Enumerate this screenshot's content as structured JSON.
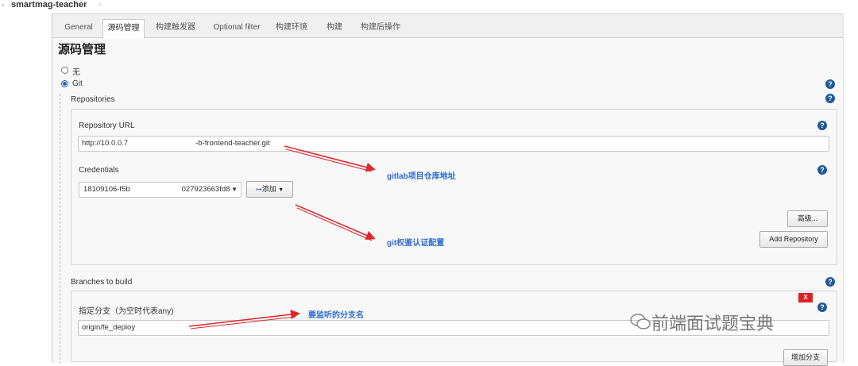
{
  "breadcrumb": {
    "arrow": "›",
    "project": "smartmag-teacher",
    "separator": "›"
  },
  "tabs": [
    {
      "label": "General"
    },
    {
      "label": "源码管理"
    },
    {
      "label": "构建触发器"
    },
    {
      "label": "Optional filter"
    },
    {
      "label": "构建环境"
    },
    {
      "label": "构建"
    },
    {
      "label": "构建后操作"
    }
  ],
  "section": {
    "title": "源码管理"
  },
  "scm_options": [
    {
      "label": "无",
      "selected": false
    },
    {
      "label": "Git",
      "selected": true
    }
  ],
  "repositories": {
    "label": "Repositories",
    "url_label": "Repository URL",
    "url_value_prefix": "http://10.0.0.7",
    "url_value_suffix": "-b-frontend-teacher.git",
    "credentials_label": "Credentials",
    "credentials_value_prefix": "18109106-f5b",
    "credentials_value_suffix": "027923663fd8",
    "add_button": "添加",
    "advanced_button": "高级...",
    "add_repository_button": "Add Repository"
  },
  "branches": {
    "label": "Branches to build",
    "specifier_label": "指定分支（为空时代表any)",
    "specifier_value": "origin/fe_deploy",
    "delete_button": "X",
    "add_branch_button": "增加分支"
  },
  "annotations": {
    "gitlab": "gitlab项目仓库地址",
    "auth": "git权鉴认证配置",
    "branch": "要监听的分支名"
  },
  "watermark": "前端面试题宝典",
  "help_icon": "?"
}
